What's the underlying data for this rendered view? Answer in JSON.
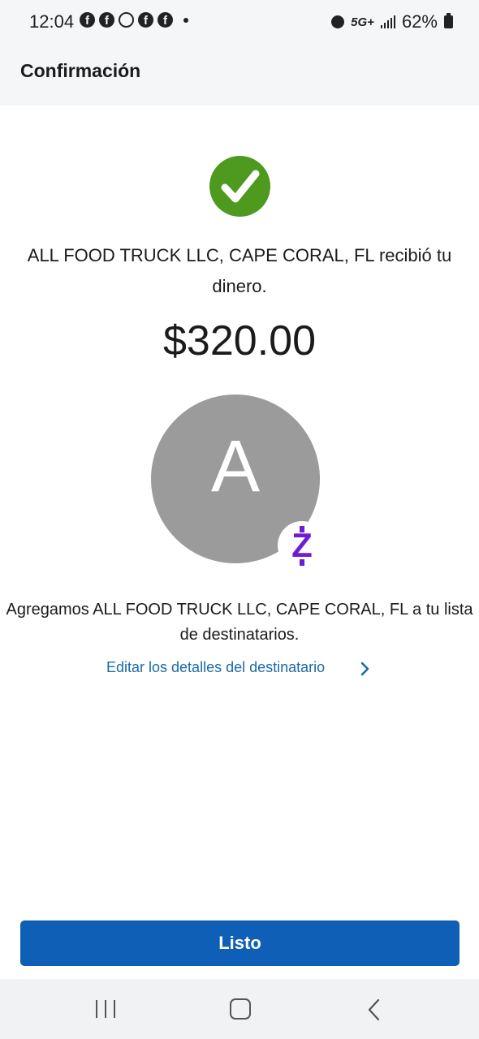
{
  "status_bar": {
    "time": "12:04",
    "network": "5G+",
    "battery": "62%"
  },
  "header": {
    "title": "Confirmación"
  },
  "confirmation": {
    "message": "ALL FOOD TRUCK LLC, CAPE CORAL, FL recibió tu dinero.",
    "amount": "$320.00",
    "avatar_letter": "A",
    "badge_letter": "Z",
    "added_message": "Agregamos ALL FOOD TRUCK LLC, CAPE CORAL, FL a tu lista de destinatarios.",
    "edit_link": "Editar los detalles del destinatario"
  },
  "footer": {
    "done_label": "Listo"
  },
  "colors": {
    "success": "#4e9a1e",
    "primary": "#0e5fb5",
    "link": "#1a6aa8",
    "zelle": "#6d1ed4",
    "avatar": "#9b9b9b"
  },
  "icons": {
    "check": "check-icon",
    "chevron": "chevron-right-icon",
    "zelle": "zelle-logo-icon"
  }
}
